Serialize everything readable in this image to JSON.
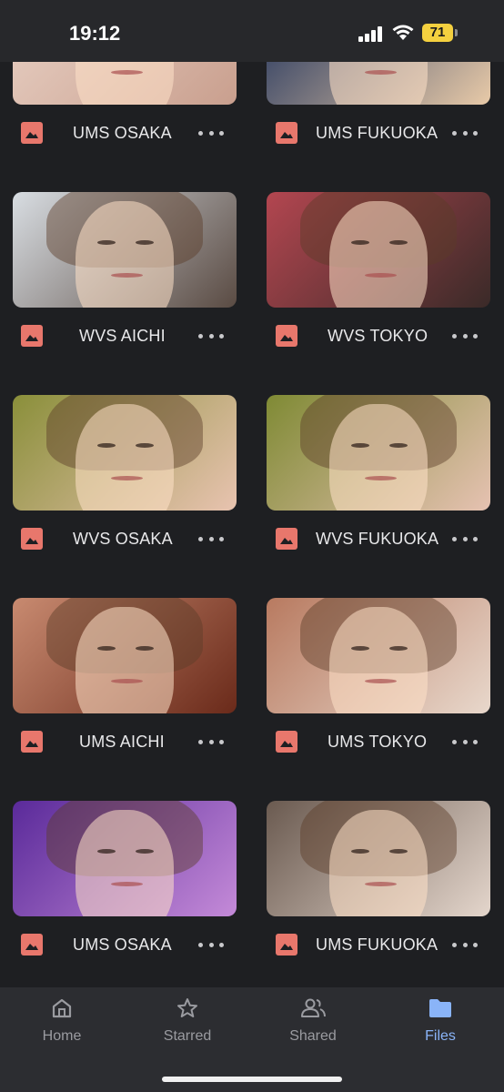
{
  "status_bar": {
    "time": "19:12",
    "battery": "71"
  },
  "files": [
    {
      "name": "UMS OSAKA"
    },
    {
      "name": "UMS FUKUOKA"
    },
    {
      "name": "WVS AICHI"
    },
    {
      "name": "WVS TOKYO"
    },
    {
      "name": "WVS OSAKA"
    },
    {
      "name": "WVS FUKUOKA"
    },
    {
      "name": "UMS AICHI"
    },
    {
      "name": "UMS TOKYO"
    },
    {
      "name": "UMS OSAKA"
    },
    {
      "name": "UMS FUKUOKA"
    }
  ],
  "nav": [
    {
      "label": "Home",
      "icon": "home-icon"
    },
    {
      "label": "Starred",
      "icon": "star-icon"
    },
    {
      "label": "Shared",
      "icon": "people-icon"
    },
    {
      "label": "Files",
      "icon": "folder-icon"
    }
  ],
  "colors": {
    "accent": "#8ab4f8",
    "file_icon": "#e8776c",
    "background": "#1e1f22",
    "nav_background": "#2c2d31"
  }
}
